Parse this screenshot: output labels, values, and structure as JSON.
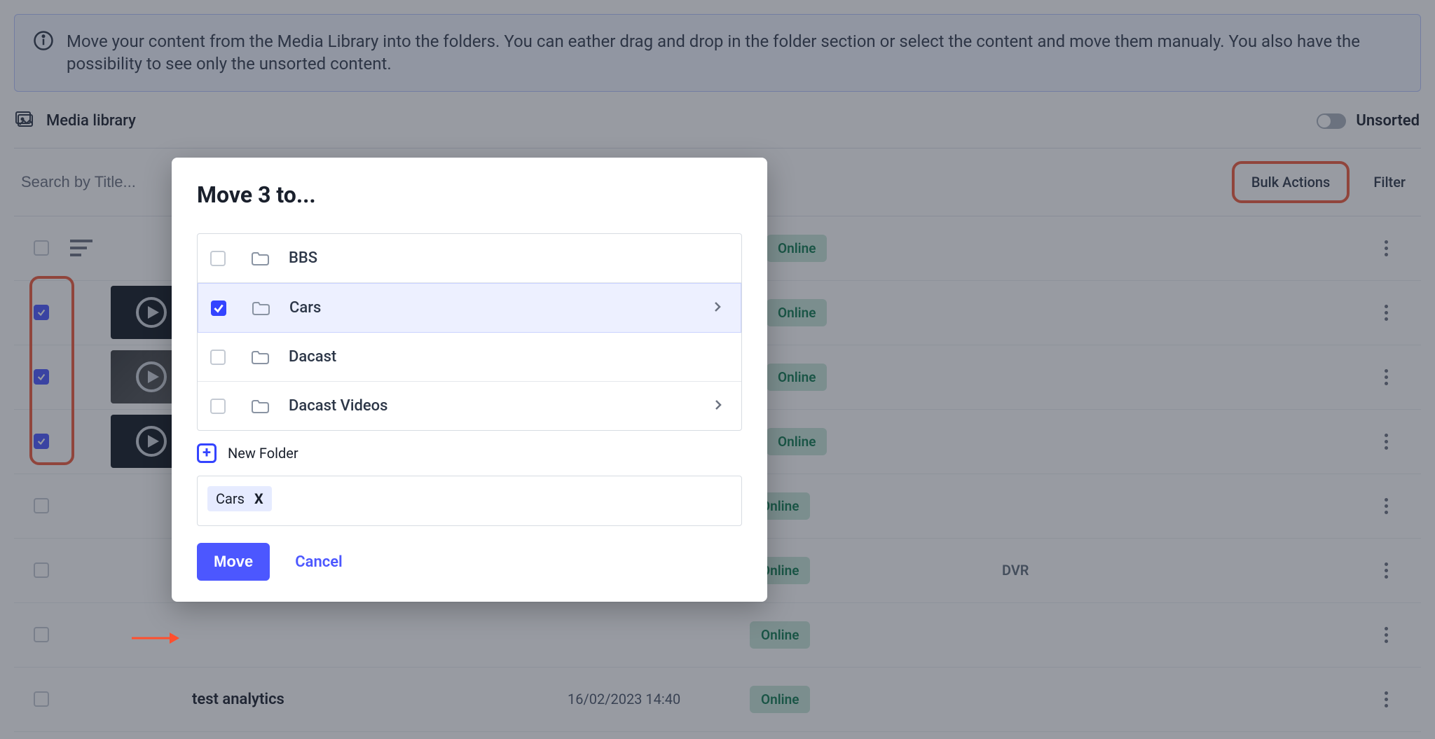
{
  "info_banner": "Move your content from the Media Library into the folders. You can eather drag and drop in the folder section or select the content and move them manualy. You also have the possibility to see only the unsorted content.",
  "library_title": "Media library",
  "unsorted_label": "Unsorted",
  "search_placeholder": "Search by Title...",
  "toolbar": {
    "bulk_actions": "Bulk Actions",
    "filter": "Filter"
  },
  "status_label": "Online",
  "dvr_label": "DVR",
  "rows": [
    {
      "title": "",
      "checked": false,
      "thumb": "icon",
      "date": "",
      "dvr": false
    },
    {
      "title": "",
      "checked": true,
      "thumb": "play",
      "date": "",
      "dvr": false
    },
    {
      "title": "",
      "checked": true,
      "thumb": "city",
      "date": "",
      "dvr": false
    },
    {
      "title": "",
      "checked": true,
      "thumb": "play",
      "date": "",
      "dvr": false
    },
    {
      "title": "",
      "checked": false,
      "thumb": "none",
      "date": "",
      "dvr": false
    },
    {
      "title": "",
      "checked": false,
      "thumb": "none",
      "date": "",
      "dvr": true
    },
    {
      "title": "",
      "checked": false,
      "thumb": "none",
      "date": "",
      "dvr": false
    },
    {
      "title": "test analytics",
      "checked": false,
      "thumb": "none",
      "date": "16/02/2023 14:40",
      "dvr": false
    }
  ],
  "modal": {
    "title": "Move 3 to...",
    "folders": [
      {
        "name": "BBS",
        "checked": false,
        "has_children": false
      },
      {
        "name": "Cars",
        "checked": true,
        "has_children": true
      },
      {
        "name": "Dacast",
        "checked": false,
        "has_children": false
      },
      {
        "name": "Dacast Videos",
        "checked": false,
        "has_children": true
      }
    ],
    "new_folder_label": "New Folder",
    "chip": {
      "label": "Cars",
      "close": "X"
    },
    "move": "Move",
    "cancel": "Cancel"
  }
}
